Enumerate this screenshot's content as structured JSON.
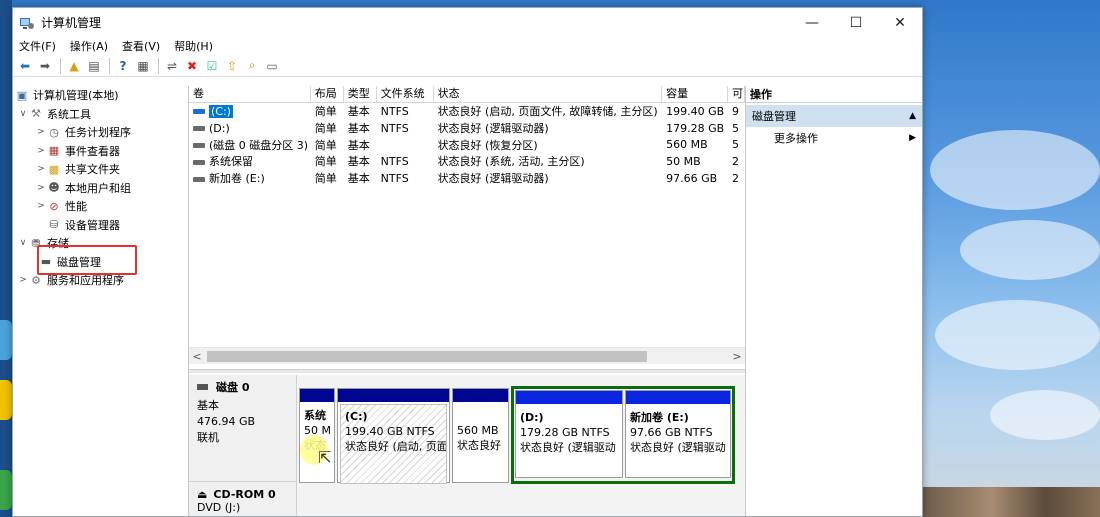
{
  "window": {
    "title": "计算机管理"
  },
  "menu": [
    "文件(F)",
    "操作(A)",
    "查看(V)",
    "帮助(H)"
  ],
  "tree": [
    {
      "label": "计算机管理(本地)",
      "icon": "computer-management-icon",
      "level": 0,
      "exp": ""
    },
    {
      "label": "系统工具",
      "icon": "tools-icon",
      "level": 1,
      "exp": "∨"
    },
    {
      "label": "任务计划程序",
      "icon": "clock-icon",
      "level": 2,
      "exp": ">"
    },
    {
      "label": "事件查看器",
      "icon": "event-viewer-icon",
      "level": 2,
      "exp": ">"
    },
    {
      "label": "共享文件夹",
      "icon": "shared-folder-icon",
      "level": 2,
      "exp": ">"
    },
    {
      "label": "本地用户和组",
      "icon": "users-icon",
      "level": 2,
      "exp": ">"
    },
    {
      "label": "性能",
      "icon": "performance-icon",
      "level": 2,
      "exp": ">"
    },
    {
      "label": "设备管理器",
      "icon": "device-manager-icon",
      "level": 2,
      "exp": ""
    },
    {
      "label": "存储",
      "icon": "storage-icon",
      "level": 1,
      "exp": "∨"
    },
    {
      "label": "磁盘管理",
      "icon": "disk-icon",
      "level": 2,
      "exp": ""
    },
    {
      "label": "服务和应用程序",
      "icon": "services-icon",
      "level": 1,
      "exp": ">"
    }
  ],
  "volumes": {
    "columns": [
      "卷",
      "布局",
      "类型",
      "文件系统",
      "状态",
      "容量",
      "可"
    ],
    "rows": [
      [
        "(C:)",
        "简单",
        "基本",
        "NTFS",
        "状态良好 (启动, 页面文件, 故障转储, 主分区)",
        "199.40 GB",
        "9"
      ],
      [
        "(D:)",
        "简单",
        "基本",
        "NTFS",
        "状态良好 (逻辑驱动器)",
        "179.28 GB",
        "5"
      ],
      [
        "(磁盘 0 磁盘分区 3)",
        "简单",
        "基本",
        "",
        "状态良好 (恢复分区)",
        "560 MB",
        "5"
      ],
      [
        "系统保留",
        "简单",
        "基本",
        "NTFS",
        "状态良好 (系统, 活动, 主分区)",
        "50 MB",
        "2"
      ],
      [
        "新加卷 (E:)",
        "简单",
        "基本",
        "NTFS",
        "状态良好 (逻辑驱动器)",
        "97.66 GB",
        "2"
      ]
    ]
  },
  "disk0": {
    "name": "磁盘 0",
    "type": "基本",
    "size": "476.94 GB",
    "status": "联机",
    "partitions": [
      {
        "name": "系统",
        "size": "50 M",
        "status": "状态"
      },
      {
        "name": "(C:)",
        "size": "199.40 GB NTFS",
        "status": "状态良好 (启动, 页面"
      },
      {
        "name": "",
        "size": "560 MB",
        "status": "状态良好"
      },
      {
        "name": "(D:)",
        "size": "179.28 GB NTFS",
        "status": "状态良好 (逻辑驱动"
      },
      {
        "name": "新加卷  (E:)",
        "size": "97.66 GB NTFS",
        "status": "状态良好 (逻辑驱动"
      }
    ]
  },
  "cdrom": {
    "name": "CD-ROM 0",
    "drive": "DVD (J:)"
  },
  "actions": {
    "header": "操作",
    "section": "磁盘管理",
    "more": "更多操作"
  }
}
